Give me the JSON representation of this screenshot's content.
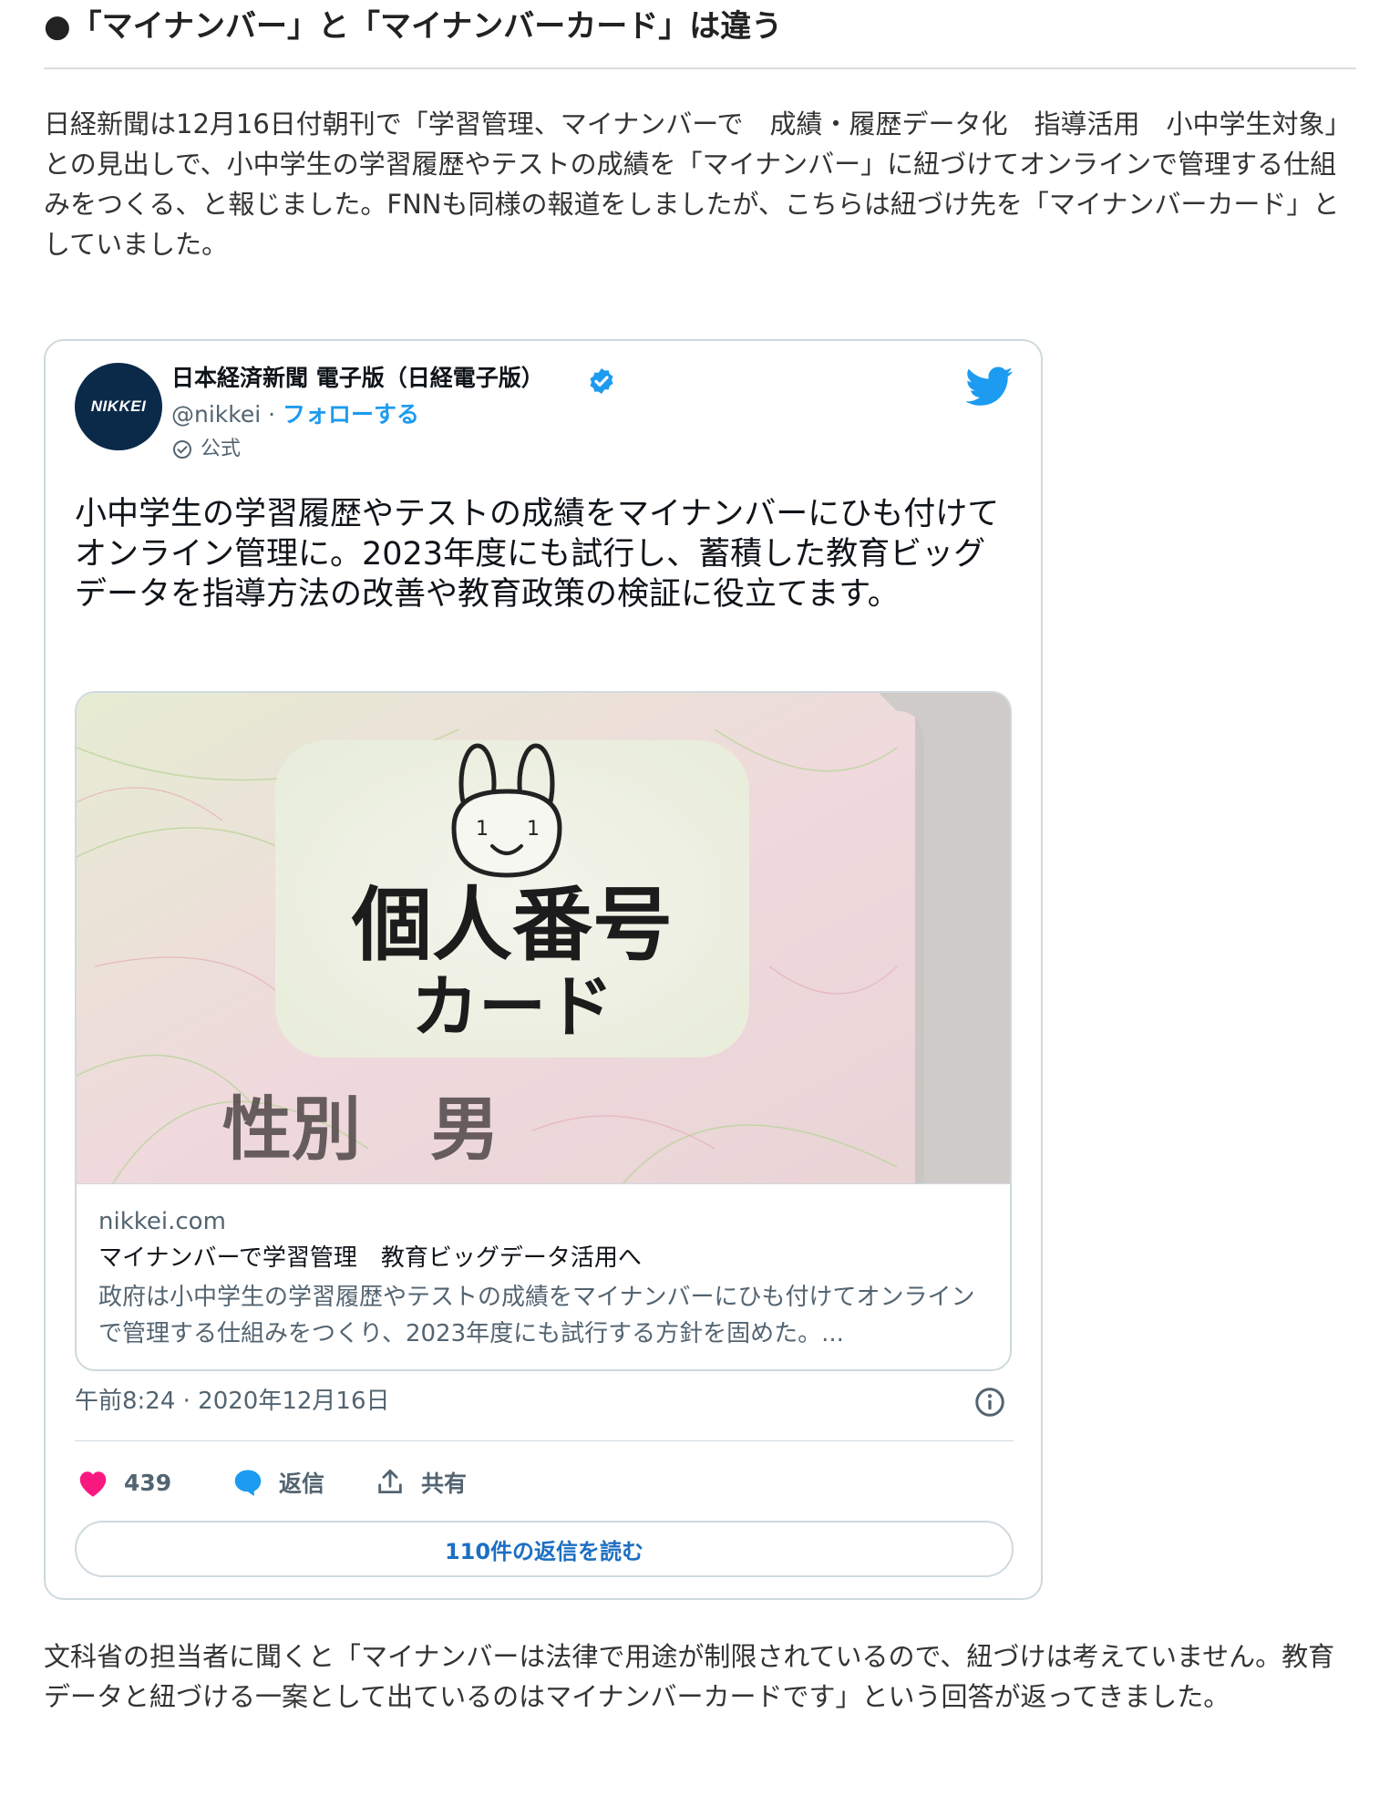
{
  "article": {
    "heading": "●「マイナンバー」と「マイナンバーカード」は違う",
    "paragraph1": "日経新聞は12月16日付朝刊で「学習管理、マイナンバーで　成績・履歴データ化　指導活用　小中学生対象」との見出しで、小中学生の学習履歴やテストの成績を「マイナンバー」に紐づけてオンラインで管理する仕組みをつくる、と報じました。FNNも同様の報道をしましたが、こちらは紐づけ先を「マイナンバーカード」としていました。",
    "paragraph2": "文科省の担当者に聞くと「マイナンバーは法律で用途が制限されているので、紐づけは考えていません。教育データと紐づける一案として出ているのはマイナンバーカードです」という回答が返ってきました。"
  },
  "tweet": {
    "avatar_text": "NIKKEI",
    "author_name": "日本経済新聞 電子版（日経電子版）",
    "handle": "@nikkei",
    "dot": " · ",
    "follow_label": "フォローする",
    "official_label": "公式",
    "text": "小中学生の学習履歴やテストの成績をマイナンバーにひも付けてオンライン管理に。2023年度にも試行し、蓄積した教育ビッグデータを指導方法の改善や教育政策の検証に役立てます。",
    "card": {
      "photo_text_line1": "個人番号",
      "photo_text_line2": "カード",
      "photo_text_gender": "性別　男",
      "domain": "nikkei.com",
      "title": "マイナンバーで学習管理　教育ビッグデータ活用へ",
      "description": "政府は小中学生の学習履歴やテストの成績をマイナンバーにひも付けてオンラインで管理する仕組みをつくり、2023年度にも試行する方針を固めた。..."
    },
    "timestamp": "午前8:24 · 2020年12月16日",
    "like_count": "439",
    "reply_label": "返信",
    "share_label": "共有",
    "read_replies_label": "110件の返信を読む"
  },
  "colors": {
    "twitter_blue": "#1d9bf0",
    "like_pink": "#f91880",
    "nikkei_navy": "#0b2a4a"
  }
}
